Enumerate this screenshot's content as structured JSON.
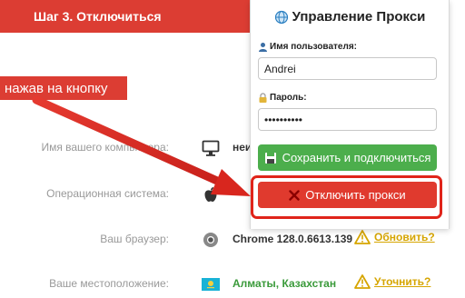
{
  "banner": {
    "step_text": "Шаг 3. Отключиться"
  },
  "hint": {
    "text": "нажав на кнопку"
  },
  "info": {
    "rows": [
      {
        "label": "Имя вашего компьютера:",
        "value": "неи",
        "icon": "monitor-icon"
      },
      {
        "label": "Операционная система:",
        "value": "",
        "icon": "apple-icon"
      },
      {
        "label": "Ваш браузер:",
        "value": "Chrome 128.0.6613.139",
        "icon": "chrome-icon",
        "action": "Обновить?"
      },
      {
        "label": "Ваше местоположение:",
        "value": "Алматы, Казахстан",
        "icon": "kazakhstan-flag-icon",
        "action": "Уточнить?"
      }
    ]
  },
  "popup": {
    "title": "Управление Прокси",
    "username_label": "Имя пользователя:",
    "username_value": "Andrei",
    "password_label": "Пароль:",
    "password_value": "••••••••••",
    "save_button": "Сохранить и подключиться",
    "disconnect_button": "Отключить прокси"
  },
  "colors": {
    "accent_red": "#dc3d33",
    "save_green": "#4cae4c",
    "disconnect_red": "#e03a2e",
    "warning_yellow": "#d6a500",
    "location_green": "#3a9a3a"
  }
}
